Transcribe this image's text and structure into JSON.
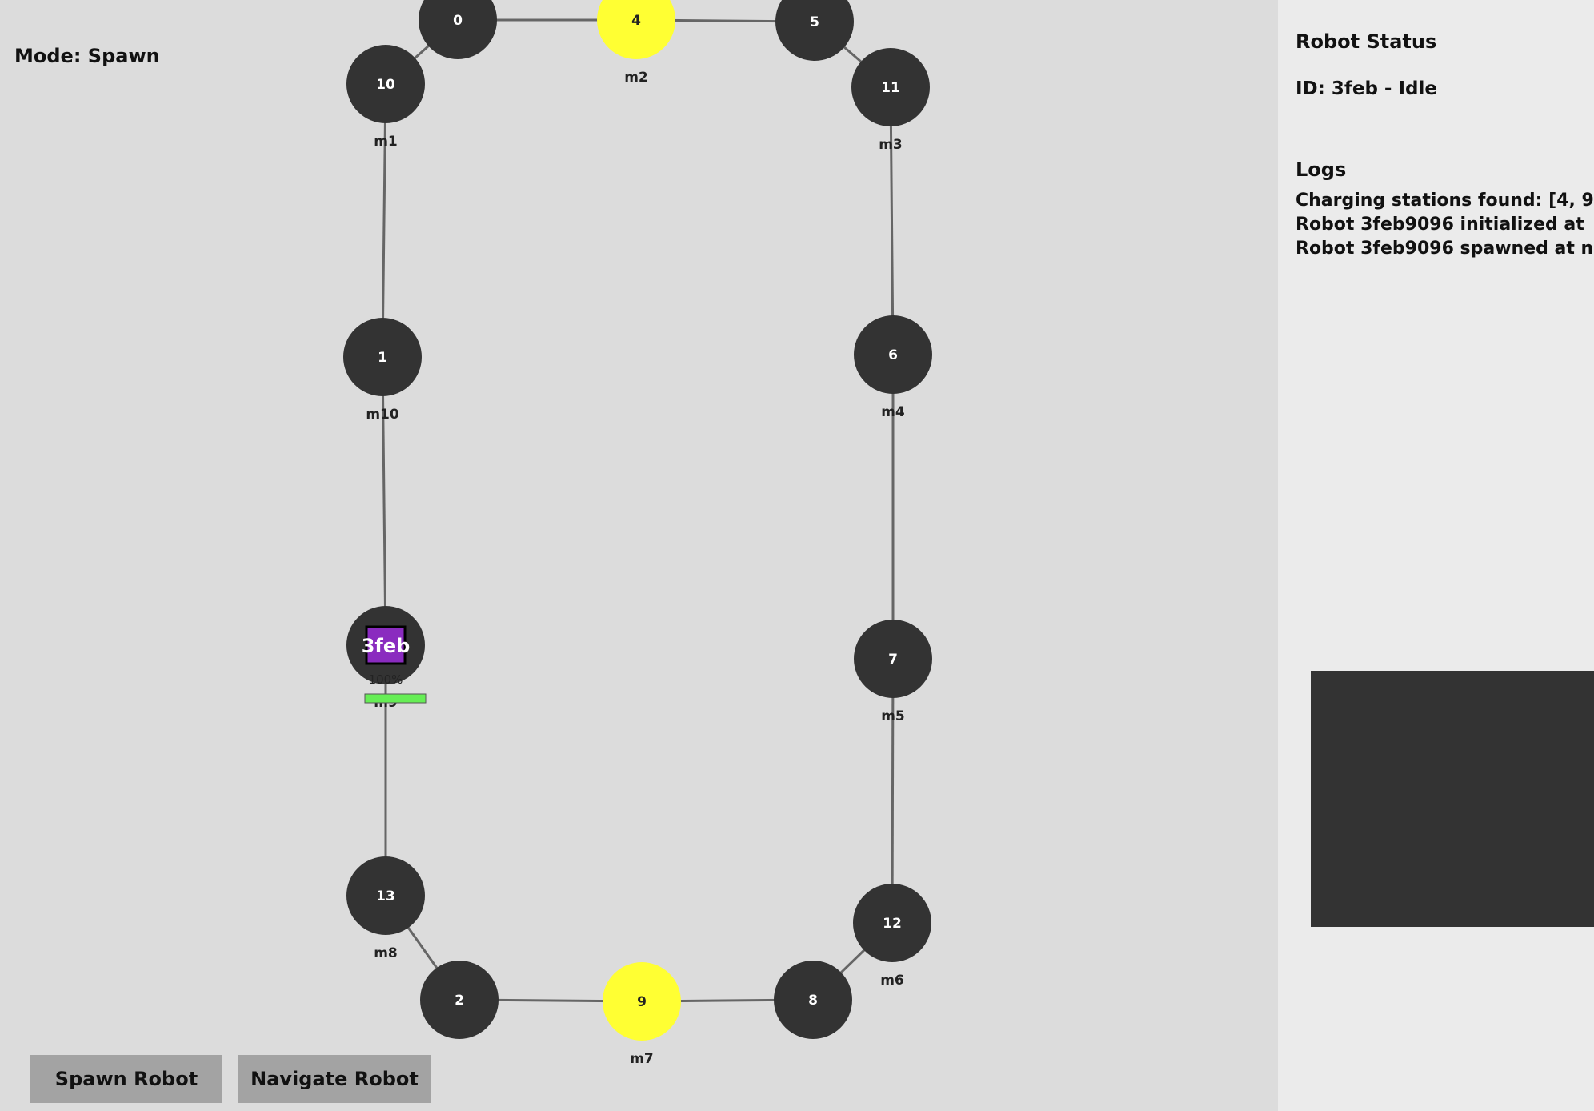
{
  "mode_label": "Mode: Spawn",
  "colors": {
    "background": "#dcdcdc",
    "panel": "#ebebeb",
    "node": "#333333",
    "charging_node": "#ffff33",
    "edge": "#666666",
    "robot_fill": "#8a2bbf",
    "battery_fill": "#66ee55",
    "button": "#a3a3a3"
  },
  "nodes": [
    {
      "id": "0",
      "label": ""
    },
    {
      "id": "4",
      "label": "m2",
      "charging": true
    },
    {
      "id": "5",
      "label": ""
    },
    {
      "id": "10",
      "label": "m1"
    },
    {
      "id": "11",
      "label": "m3"
    },
    {
      "id": "1",
      "label": "m10"
    },
    {
      "id": "6",
      "label": "m4"
    },
    {
      "id": "7",
      "label": "m5"
    },
    {
      "id": "13",
      "label": "m8"
    },
    {
      "id": "12",
      "label": "m6"
    },
    {
      "id": "2",
      "label": ""
    },
    {
      "id": "9",
      "label": "m7",
      "charging": true
    },
    {
      "id": "8",
      "label": ""
    },
    {
      "id": "",
      "label": "m9"
    }
  ],
  "robot": {
    "short_id": "3feb",
    "battery_text": "100%",
    "battery_level": 1.0
  },
  "panel": {
    "status_heading": "Robot Status",
    "status_line": "ID: 3feb - Idle",
    "logs_heading": "Logs",
    "logs": [
      "Charging stations found: [4, 9",
      "Robot 3feb9096 initialized at",
      "Robot 3feb9096 spawned at n"
    ]
  },
  "buttons": {
    "spawn": "Spawn Robot",
    "navigate": "Navigate Robot"
  }
}
